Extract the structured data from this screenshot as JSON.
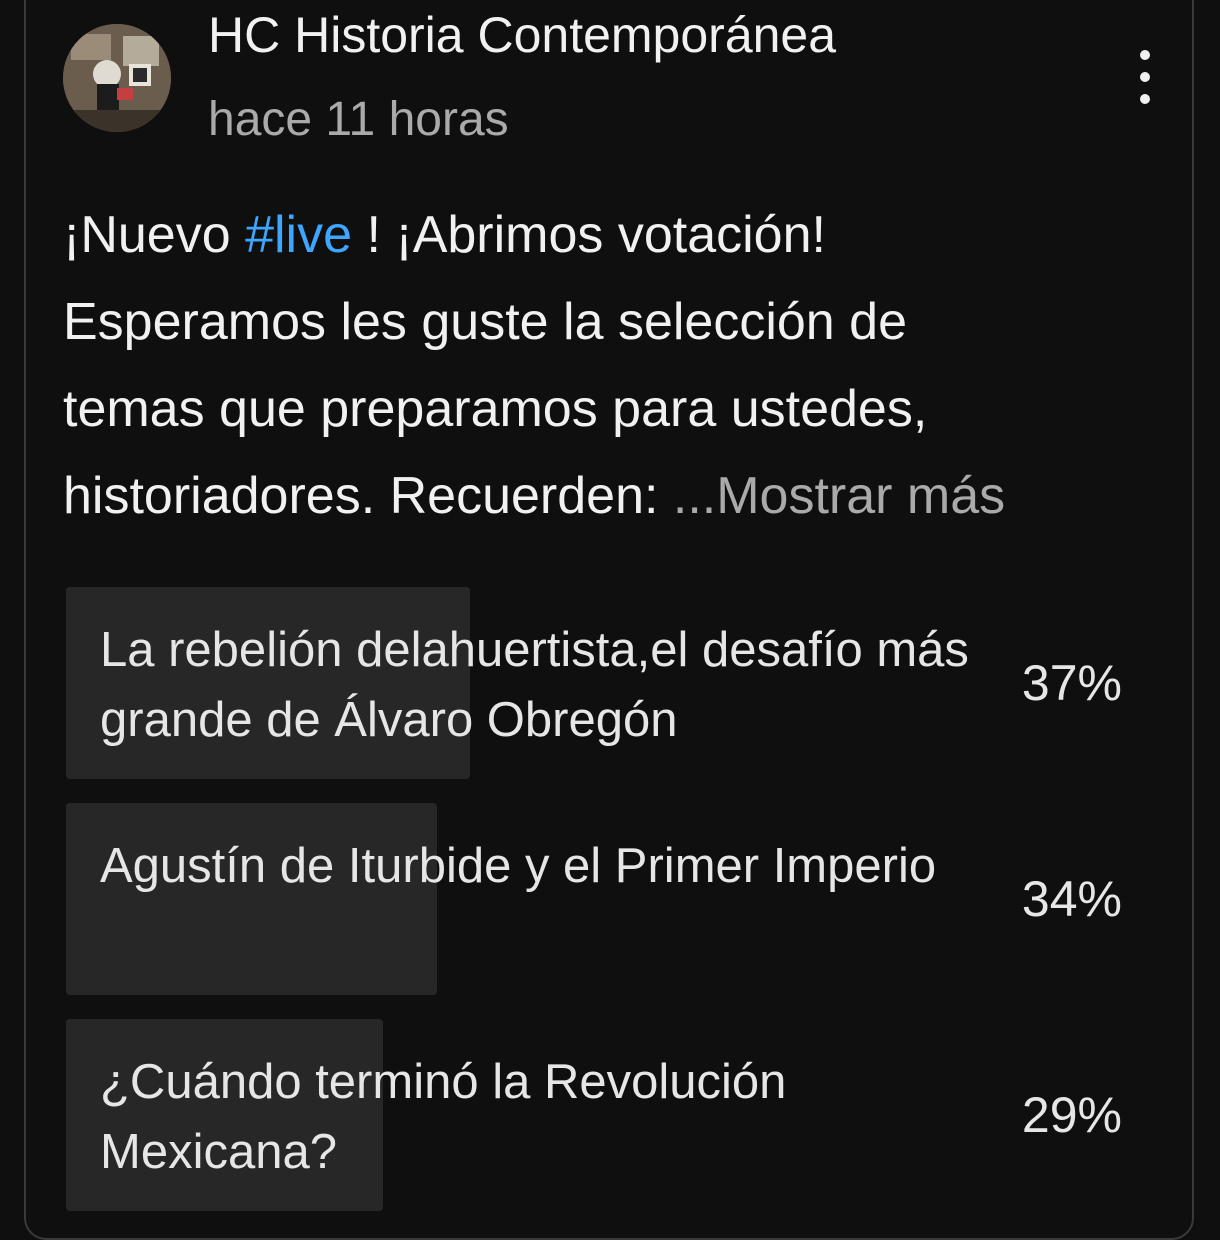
{
  "post": {
    "channel_name": "HC Historia Contemporánea",
    "timestamp": "hace 11 horas",
    "text_line1_before": "¡Nuevo ",
    "hashtag": "#live",
    "text_line1_after": " ! ¡Abrimos votación!",
    "text_line2": "Esperamos les guste la selección de",
    "text_line3": "temas que preparamos para ustedes,",
    "text_line4": "historiadores. Recuerden: ",
    "show_more": "...Mostrar más"
  },
  "poll": {
    "options": [
      {
        "label": "La rebelión delahuertista,el desafío más grande de Álvaro Obregón",
        "percent": "37%",
        "value": 37
      },
      {
        "label": "Agustín de Iturbide y el Primer Imperio",
        "percent": "34%",
        "value": 34
      },
      {
        "label": "¿Cuándo terminó la Revolución Mexicana?",
        "percent": "29%",
        "value": 29
      }
    ]
  },
  "colors": {
    "background": "#0f0f0f",
    "text": "#f1f1f1",
    "secondary_text": "#aaaaaa",
    "hashtag": "#3ea6ff",
    "poll_fill": "#272727"
  },
  "icons": {
    "menu": "more-vertical-icon",
    "avatar": "channel-avatar"
  }
}
